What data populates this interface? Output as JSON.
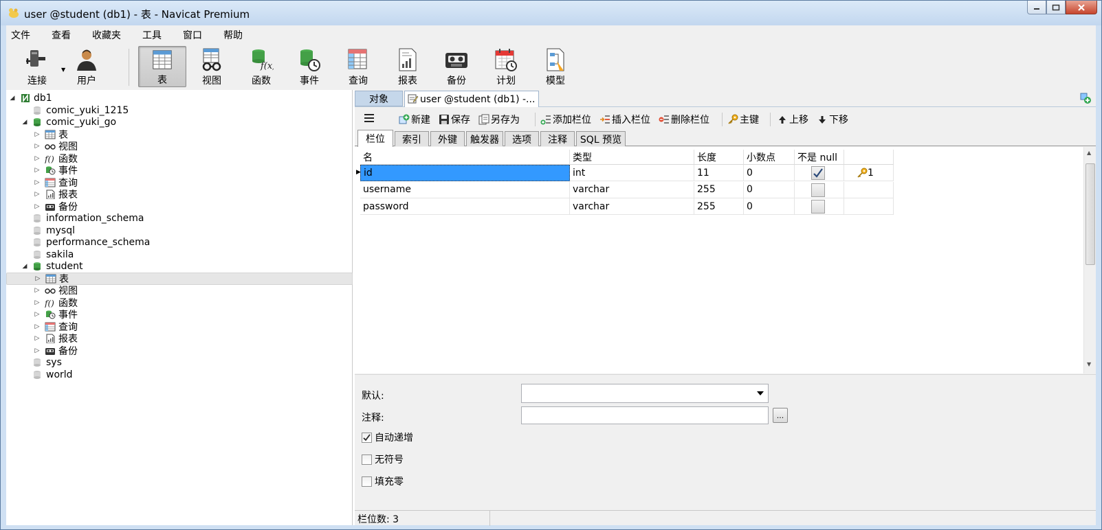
{
  "window": {
    "title": "user @student (db1) - 表 - Navicat Premium"
  },
  "menu": [
    "文件",
    "查看",
    "收藏夹",
    "工具",
    "窗口",
    "帮助"
  ],
  "toolbar": [
    {
      "label": "连接",
      "icon": "connection-icon"
    },
    {
      "label": "用户",
      "icon": "user-icon"
    },
    {
      "label": "表",
      "icon": "table-icon",
      "active": true
    },
    {
      "label": "视图",
      "icon": "view-icon"
    },
    {
      "label": "函数",
      "icon": "function-icon"
    },
    {
      "label": "事件",
      "icon": "event-icon"
    },
    {
      "label": "查询",
      "icon": "query-icon"
    },
    {
      "label": "报表",
      "icon": "report-icon"
    },
    {
      "label": "备份",
      "icon": "backup-icon"
    },
    {
      "label": "计划",
      "icon": "schedule-icon"
    },
    {
      "label": "模型",
      "icon": "model-icon"
    }
  ],
  "tree": [
    {
      "label": "db1",
      "level": 0,
      "arrow": "open",
      "icon": "connection"
    },
    {
      "label": "comic_yuki_1215",
      "level": 1,
      "arrow": "",
      "icon": "db-gray"
    },
    {
      "label": "comic_yuki_go",
      "level": 1,
      "arrow": "open",
      "icon": "db-green"
    },
    {
      "label": "表",
      "level": 2,
      "arrow": "closed",
      "icon": "table"
    },
    {
      "label": "视图",
      "level": 2,
      "arrow": "closed",
      "icon": "view"
    },
    {
      "label": "函数",
      "level": 2,
      "arrow": "closed",
      "icon": "function"
    },
    {
      "label": "事件",
      "level": 2,
      "arrow": "closed",
      "icon": "event"
    },
    {
      "label": "查询",
      "level": 2,
      "arrow": "closed",
      "icon": "query"
    },
    {
      "label": "报表",
      "level": 2,
      "arrow": "closed",
      "icon": "report"
    },
    {
      "label": "备份",
      "level": 2,
      "arrow": "closed",
      "icon": "backup"
    },
    {
      "label": "information_schema",
      "level": 1,
      "arrow": "",
      "icon": "db-gray"
    },
    {
      "label": "mysql",
      "level": 1,
      "arrow": "",
      "icon": "db-gray"
    },
    {
      "label": "performance_schema",
      "level": 1,
      "arrow": "",
      "icon": "db-gray"
    },
    {
      "label": "sakila",
      "level": 1,
      "arrow": "",
      "icon": "db-gray"
    },
    {
      "label": "student",
      "level": 1,
      "arrow": "open",
      "icon": "db-green"
    },
    {
      "label": "表",
      "level": 2,
      "arrow": "closed",
      "icon": "table",
      "selected": true
    },
    {
      "label": "视图",
      "level": 2,
      "arrow": "closed",
      "icon": "view"
    },
    {
      "label": "函数",
      "level": 2,
      "arrow": "closed",
      "icon": "function"
    },
    {
      "label": "事件",
      "level": 2,
      "arrow": "closed",
      "icon": "event"
    },
    {
      "label": "查询",
      "level": 2,
      "arrow": "closed",
      "icon": "query"
    },
    {
      "label": "报表",
      "level": 2,
      "arrow": "closed",
      "icon": "report"
    },
    {
      "label": "备份",
      "level": 2,
      "arrow": "closed",
      "icon": "backup"
    },
    {
      "label": "sys",
      "level": 1,
      "arrow": "",
      "icon": "db-gray"
    },
    {
      "label": "world",
      "level": 1,
      "arrow": "",
      "icon": "db-gray"
    }
  ],
  "tabs": {
    "objects": "对象",
    "document": "user @student (db1) -..."
  },
  "designer_toolbar": {
    "new": "新建",
    "save": "保存",
    "save_as": "另存为",
    "add_field": "添加栏位",
    "insert_field": "插入栏位",
    "delete_field": "删除栏位",
    "primary_key": "主键",
    "move_up": "上移",
    "move_down": "下移"
  },
  "subtabs": [
    "栏位",
    "索引",
    "外键",
    "触发器",
    "选项",
    "注释",
    "SQL 预览"
  ],
  "grid": {
    "headers": [
      "名",
      "类型",
      "长度",
      "小数点",
      "不是 null",
      ""
    ],
    "rows": [
      {
        "name": "id",
        "type": "int",
        "length": "11",
        "decimals": "0",
        "not_null": true,
        "key": "1"
      },
      {
        "name": "username",
        "type": "varchar",
        "length": "255",
        "decimals": "0",
        "not_null": false,
        "key": ""
      },
      {
        "name": "password",
        "type": "varchar",
        "length": "255",
        "decimals": "0",
        "not_null": false,
        "key": ""
      }
    ]
  },
  "props": {
    "default_label": "默认:",
    "comment_label": "注释:",
    "ellipsis": "...",
    "auto_increment": {
      "label": "自动递增",
      "checked": true
    },
    "unsigned": {
      "label": "无符号",
      "checked": false
    },
    "zerofill": {
      "label": "填充零",
      "checked": false
    }
  },
  "status": {
    "field_count": "栏位数: 3"
  }
}
